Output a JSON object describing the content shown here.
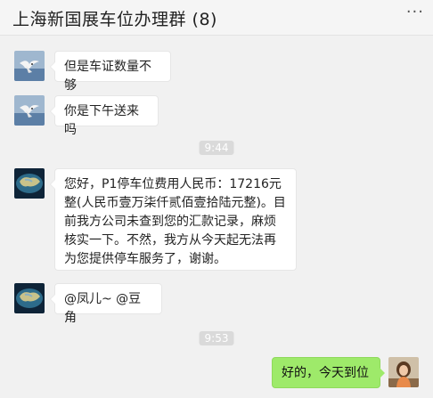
{
  "header": {
    "title": "上海新国展车位办理群 (8)",
    "more_icon": "more-dots-icon",
    "more_glyph": "···"
  },
  "messages": [
    {
      "text": "但是车证数量不够",
      "side": "left",
      "avatar": "seagull-avatar"
    },
    {
      "text": "你是下午送来吗",
      "side": "left",
      "avatar": "seagull-avatar"
    },
    {
      "time": "9:44"
    },
    {
      "text": "您好，P1停车位费用人民币：17216元整(人民币壹万柒仟贰佰壹拾陆元整)。目前我方公司未查到您的汇款记录，麻烦核实一下。不然，我方从今天起无法再为您提供停车服务了，谢谢。",
      "side": "left",
      "avatar": "globe-avatar"
    },
    {
      "text": "@凤儿~ @豆角",
      "side": "left",
      "avatar": "globe-avatar"
    },
    {
      "time": "9:53"
    },
    {
      "text": "好的，今天到位",
      "side": "right",
      "avatar": "girl-avatar"
    }
  ],
  "colors": {
    "background": "#f1f1f1",
    "self_bubble": "#9eea6a",
    "other_bubble": "#ffffff",
    "time_badge": "#dadada"
  }
}
